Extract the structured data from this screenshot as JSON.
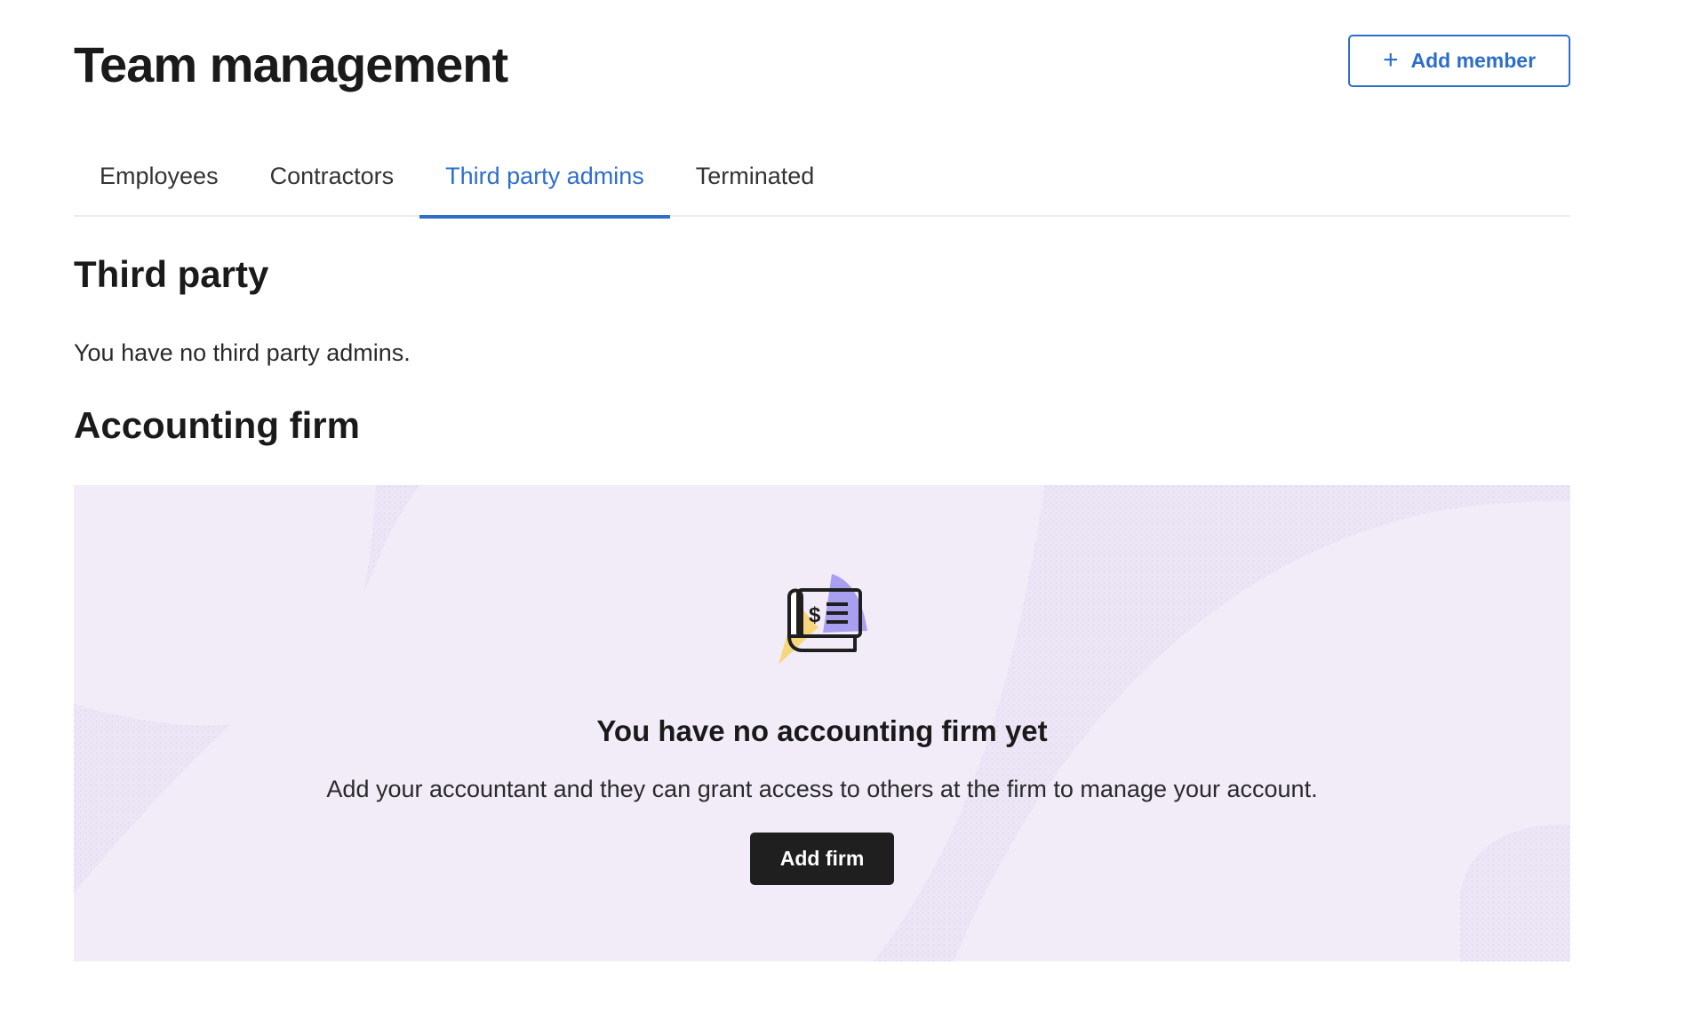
{
  "header": {
    "title": "Team management",
    "add_member_icon": "+",
    "add_member_label": "Add member"
  },
  "tabs": [
    {
      "label": "Employees",
      "active": false
    },
    {
      "label": "Contractors",
      "active": false
    },
    {
      "label": "Third party admins",
      "active": true
    },
    {
      "label": "Terminated",
      "active": false
    }
  ],
  "third_party": {
    "title": "Third party",
    "empty_text": "You have no third party admins."
  },
  "accounting_firm": {
    "title": "Accounting firm",
    "illustration_icon": "check-document-icon",
    "empty_title": "You have no accounting firm yet",
    "empty_description": "Add your accountant and they can grant access to others at the firm to manage your account.",
    "add_firm_label": "Add firm"
  },
  "colors": {
    "accent": "#2d6ecb",
    "banner_bg": "#f2ecf9",
    "banner_texture": "#e6dff0",
    "dark_button": "#1f1f1f",
    "illus_yellow": "#f7d77e",
    "illus_purple": "#a99ff0"
  }
}
